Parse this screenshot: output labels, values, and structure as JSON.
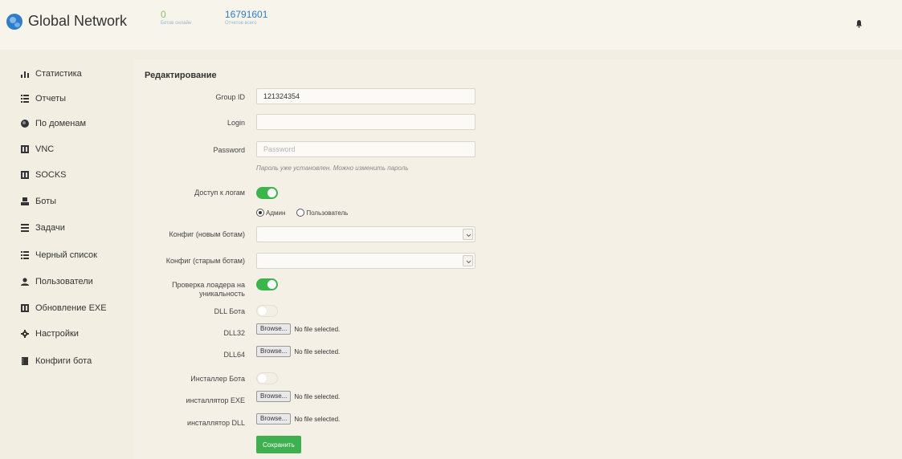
{
  "header": {
    "title": "Global Network",
    "online_count": "0",
    "online_caption": "Ботов онлайн",
    "reports_count": "16791601",
    "reports_caption": "Отчетов всего"
  },
  "sidebar": {
    "items": [
      {
        "label": "Статистика",
        "icon": "bar-chart-icon"
      },
      {
        "label": "Отчеты",
        "icon": "list-icon"
      },
      {
        "label": "По доменам",
        "icon": "globe-icon"
      },
      {
        "label": "VNC",
        "icon": "window-icon"
      },
      {
        "label": "SOCKS",
        "icon": "window-icon"
      },
      {
        "label": "Боты",
        "icon": "bot-icon"
      },
      {
        "label": "Задачи",
        "icon": "tasks-icon"
      },
      {
        "label": "Черный список",
        "icon": "list-icon"
      },
      {
        "label": "Пользователи",
        "icon": "user-icon"
      },
      {
        "label": "Обновление EXE",
        "icon": "window-icon"
      },
      {
        "label": "Настройки",
        "icon": "gear-icon"
      },
      {
        "label": "Конфиги бота",
        "icon": "book-icon"
      }
    ]
  },
  "form": {
    "title": "Редактирование",
    "group_id_label": "Group ID",
    "group_id_value": "121324354",
    "login_label": "Login",
    "login_value": "",
    "password_label": "Password",
    "password_placeholder": "Password",
    "password_hint": "Пароль уже установлен. Можно изменить пароль",
    "log_access_label": "Доступ к логам",
    "log_access_on": true,
    "role_admin": "Админ",
    "role_user": "Пользователь",
    "role_selected": "Админ",
    "config_new_label": "Конфиг (новым ботам)",
    "config_old_label": "Конфиг (старым ботам)",
    "loader_check_label_1": "Проверка лоадера на",
    "loader_check_label_2": "уникальность",
    "loader_check_on": true,
    "dll_bot_label": "DLL Бота",
    "dll_bot_on": false,
    "dll32_label": "DLL32",
    "dll64_label": "DLL64",
    "installer_bot_label": "Инсталлер Бота",
    "installer_bot_on": false,
    "installer_exe_label": "инсталлятор EXE",
    "installer_dll_label": "инсталлятор DLL",
    "browse_label": "Browse...",
    "no_file_label": "No file selected.",
    "save_label": "Сохранить"
  },
  "colors": {
    "accent_green": "#3ab54a",
    "brand_blue": "#2f7dc8",
    "background": "#f2eee2"
  }
}
